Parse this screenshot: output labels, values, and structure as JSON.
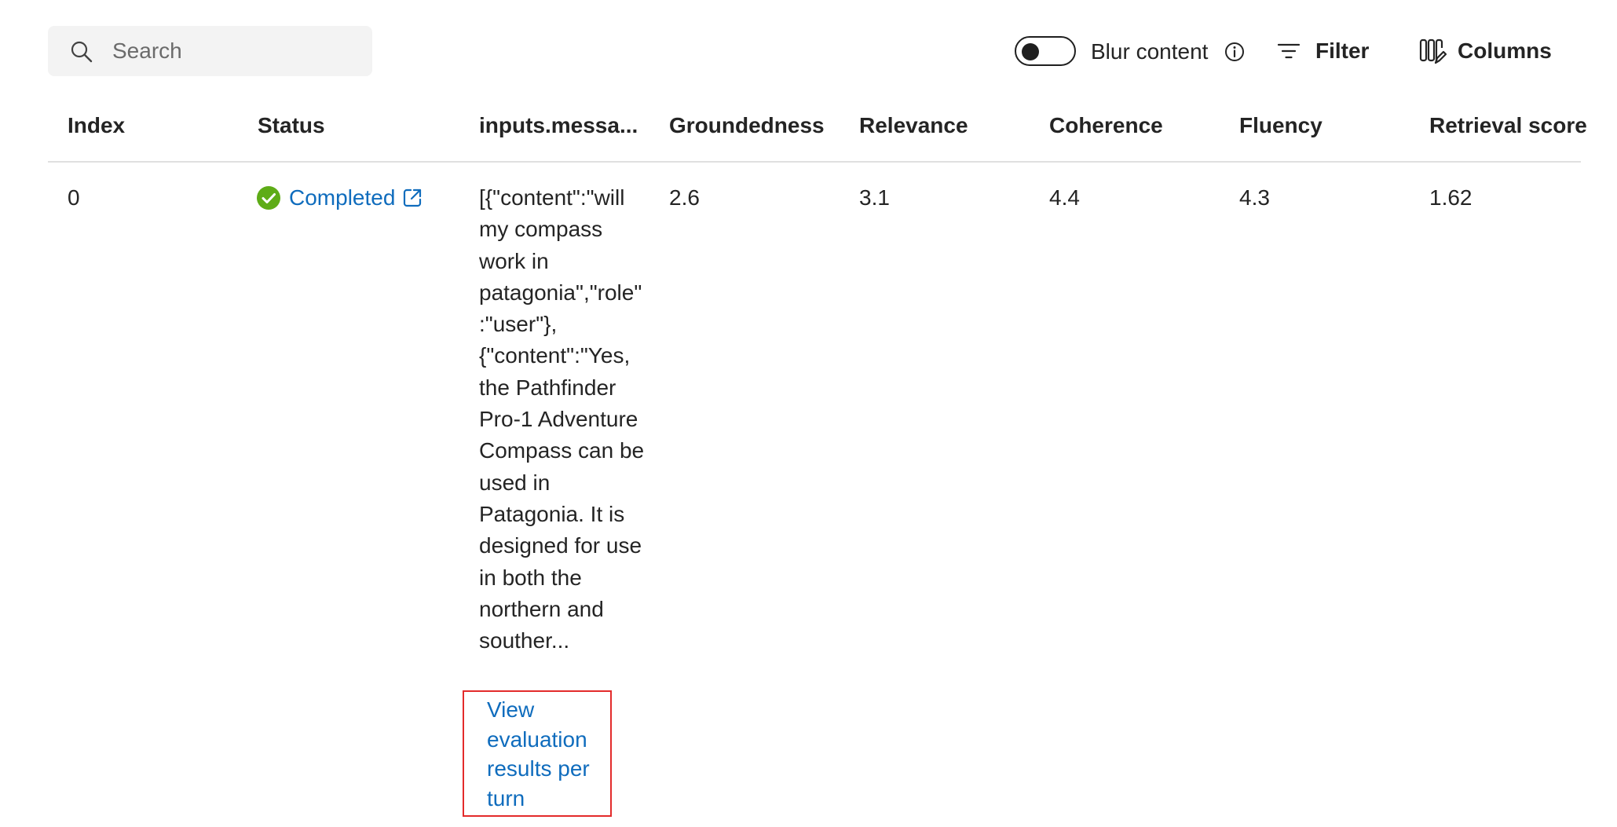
{
  "toolbar": {
    "search": {
      "placeholder": "Search",
      "value": ""
    },
    "blur_toggle": {
      "label": "Blur content",
      "checked": false
    },
    "filter_label": "Filter",
    "columns_label": "Columns"
  },
  "table": {
    "columns": [
      "Index",
      "Status",
      "inputs.messa...",
      "Groundedness",
      "Relevance",
      "Coherence",
      "Fluency",
      "Retrieval score"
    ],
    "rows": [
      {
        "index": "0",
        "status": "Completed",
        "messages": "[{\"content\":\"will my compass work in patagonia\",\"role\":\"user\"},{\"content\":\"Yes, the Pathfinder Pro-1 Adventure Compass can be used in Patagonia. It is designed for use in both the northern and souther...",
        "view_link": "View evaluation results per turn",
        "groundedness": "2.6",
        "relevance": "3.1",
        "coherence": "4.4",
        "fluency": "4.3",
        "retrieval_score": "1.62"
      }
    ]
  },
  "colors": {
    "link": "#0f6cbd",
    "success": "#5eac17",
    "highlight_border": "#e32b2b",
    "search_bg": "#f3f3f3"
  },
  "icons": {
    "search": "search-icon",
    "info": "info-icon",
    "filter": "filter-icon",
    "columns": "columns-icon",
    "status_ok": "check-circle-icon",
    "external": "external-link-icon"
  }
}
